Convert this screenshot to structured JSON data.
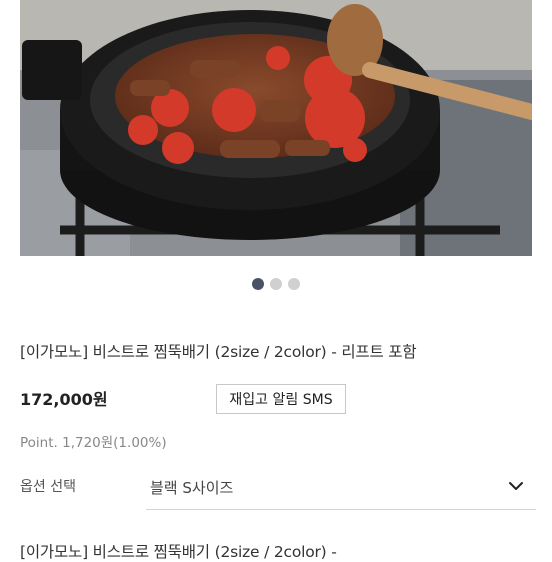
{
  "product": {
    "title": "[이가모노] 비스트로 찜뚝배기 (2size / 2color) - 리프트 포함",
    "price": "172,000원",
    "restock_button": "재입고 알림 SMS",
    "points": "Point. 1,720원(1.00%)",
    "option_label": "옵션 선택",
    "option_value": "블랙 S사이즈",
    "selected_title_partial": "[이가모노] 비스트로 찜뚝배기 (2size / 2color) -"
  },
  "gallery": {
    "image_icon": "product-photo-clay-pot-stew",
    "total_slides": 3,
    "active_slide": 1
  },
  "colors": {
    "dot_active": "#4a5366",
    "dot_inactive": "#d0d0d0"
  }
}
